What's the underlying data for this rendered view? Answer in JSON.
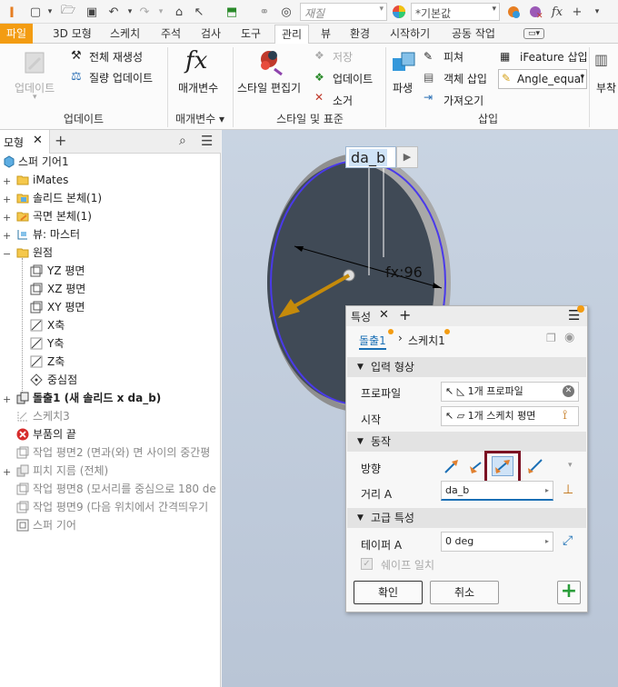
{
  "qat": {
    "material_placeholder": "재질",
    "appearance_value": "*기본값"
  },
  "tabs": [
    {
      "label": "파일"
    },
    {
      "label": "3D 모형"
    },
    {
      "label": "스케치"
    },
    {
      "label": "주석"
    },
    {
      "label": "검사"
    },
    {
      "label": "도구"
    },
    {
      "label": "관리"
    },
    {
      "label": "뷰"
    },
    {
      "label": "환경"
    },
    {
      "label": "시작하기"
    },
    {
      "label": "공동 작업"
    }
  ],
  "ribbon": {
    "update": "업데이트",
    "rebuild_all": "전체 재생성",
    "mass_update": "질량 업데이트",
    "params": "매개변수",
    "style_editor": "스타일 편집기",
    "save": "저장",
    "update2": "업데이트",
    "purge": "소거",
    "derive": "파생",
    "ifeature_insert": "iFeature 삽입",
    "pierce": "피쳐",
    "object_insert": "객체 삽입",
    "import": "가져오기",
    "angle_equal": "Angle_equal",
    "attach": "부착",
    "groups": {
      "update": "업데이트",
      "params": "매개변수 ▾",
      "styles": "스타일 및 표준",
      "insert": "삽입"
    }
  },
  "browser": {
    "tab_label": "모형",
    "items": [
      {
        "label": "스퍼 기어1"
      },
      {
        "label": "iMates"
      },
      {
        "label": "솔리드 본체(1)"
      },
      {
        "label": "곡면 본체(1)"
      },
      {
        "label": "뷰: 마스터"
      },
      {
        "label": "원점"
      },
      {
        "label": "YZ 평면"
      },
      {
        "label": "XZ 평면"
      },
      {
        "label": "XY 평면"
      },
      {
        "label": "X축"
      },
      {
        "label": "Y축"
      },
      {
        "label": "Z축"
      },
      {
        "label": "중심점"
      },
      {
        "label": "돌출1 (새 솔리드 x da_b)"
      },
      {
        "label": "스케치3"
      },
      {
        "label": "부품의 끝"
      },
      {
        "label": "작업 평면2 (면과(와) 면 사이의 중간평"
      },
      {
        "label": "피치 지름 (전체)"
      },
      {
        "label": "작업 평면8 (모서리를 중심으로 180 de"
      },
      {
        "label": "작업 평면9 (다음 위치에서 간격띄우기"
      },
      {
        "label": "스퍼 기어"
      }
    ]
  },
  "viewport": {
    "dim_edit_value": "da_b",
    "dim_label": "fx:96"
  },
  "props": {
    "title": "특성",
    "breadcrumb_1": "돌출1",
    "breadcrumb_2": "스케치1",
    "sec_input": "입력 형상",
    "profile_label": "프로파일",
    "profile_value": "1개 프로파일",
    "start_label": "시작",
    "start_value": "1개 스케치 평면",
    "sec_behavior": "동작",
    "direction_label": "방향",
    "distance_label": "거리 A",
    "distance_value": "da_b",
    "sec_advanced": "고급 특성",
    "taper_label": "테이퍼 A",
    "taper_value": "0 deg",
    "shape_match": "쉐이프 일치",
    "ok": "확인",
    "cancel": "취소"
  },
  "colors": {
    "accent_orange": "#f39c12",
    "highlight_box": "#7b1023",
    "link_blue": "#1a6fb5"
  }
}
